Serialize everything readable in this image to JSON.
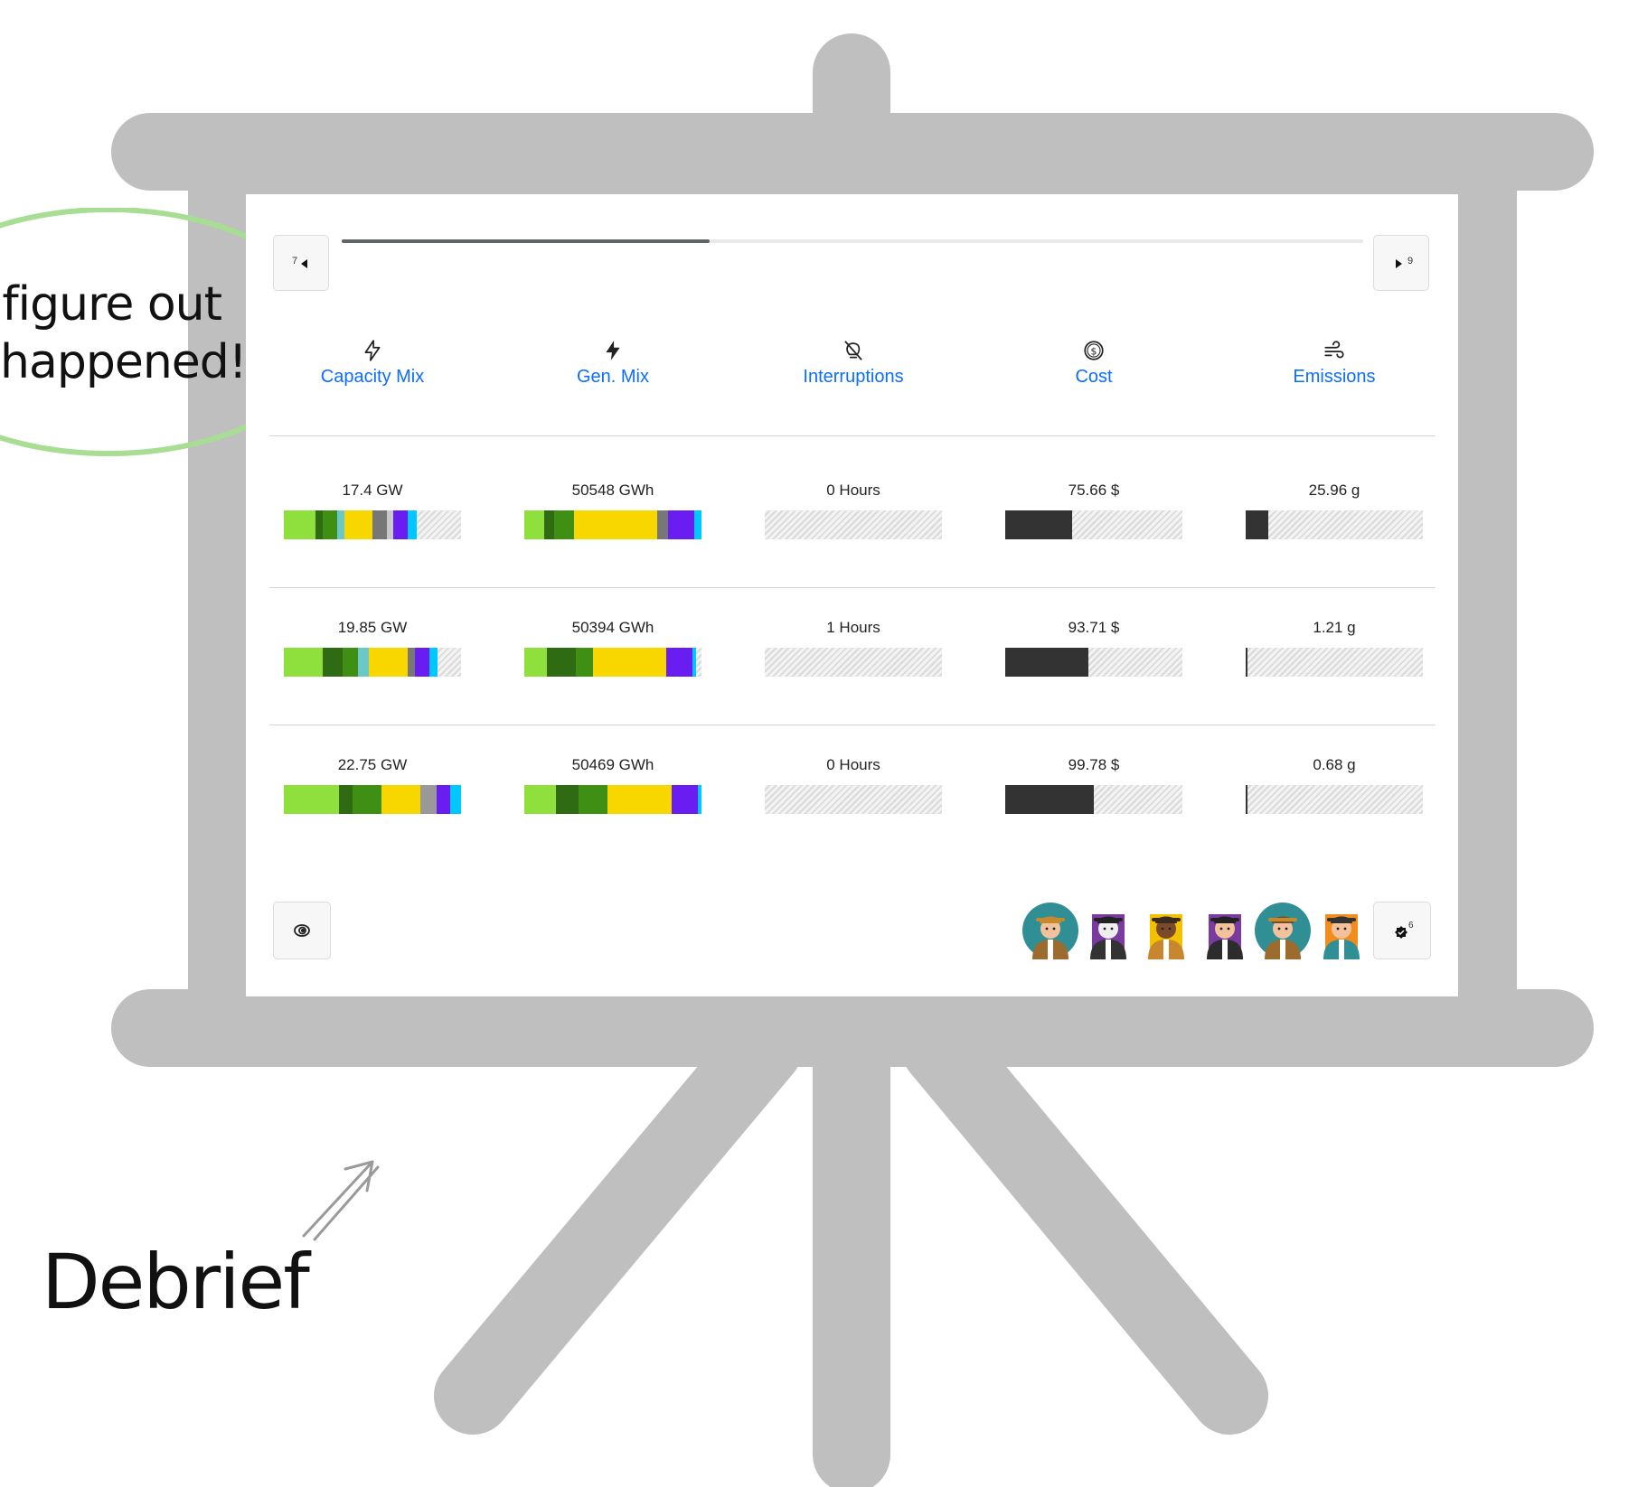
{
  "callout": {
    "line1": "figure out",
    "line2": "happened!"
  },
  "caption": "Debrief",
  "nav": {
    "prev_number": "7",
    "next_number": "9",
    "progress_fraction": 0.36
  },
  "columns": [
    {
      "label": "Capacity Mix",
      "icon": "lightning-outline-icon"
    },
    {
      "label": "Gen. Mix",
      "icon": "lightning-filled-icon"
    },
    {
      "label": "Interruptions",
      "icon": "bulb-off-icon"
    },
    {
      "label": "Cost",
      "icon": "dollar-coin-icon"
    },
    {
      "label": "Emissions",
      "icon": "wind-icon"
    }
  ],
  "rows": [
    {
      "capacity": {
        "label": "17.4 GW",
        "segments": [
          [
            "#8fe03c",
            0.18
          ],
          [
            "#2f6b12",
            0.04
          ],
          [
            "#3f8f15",
            0.08
          ],
          [
            "#6ac8c8",
            0.04
          ],
          [
            "#f8d700",
            0.16
          ],
          [
            "#777777",
            0.08
          ],
          [
            "#c9c9c9",
            0.04
          ],
          [
            "#6a1df0",
            0.08
          ],
          [
            "#00c8ff",
            0.05
          ]
        ]
      },
      "generation": {
        "label": "50548 GWh",
        "segments": [
          [
            "#8fe03c",
            0.11
          ],
          [
            "#2f6b12",
            0.06
          ],
          [
            "#3f8f15",
            0.11
          ],
          [
            "#f8d700",
            0.47
          ],
          [
            "#777777",
            0.06
          ],
          [
            "#6a1df0",
            0.15
          ],
          [
            "#00c8ff",
            0.04
          ]
        ]
      },
      "interruptions": {
        "label": "0 Hours",
        "fraction": 0
      },
      "cost": {
        "label": "75.66 $",
        "fraction": 0.38
      },
      "emissions": {
        "label": "25.96 g",
        "fraction": 0.13
      }
    },
    {
      "capacity": {
        "label": "19.85 GW",
        "segments": [
          [
            "#8fe03c",
            0.22
          ],
          [
            "#2f6b12",
            0.11
          ],
          [
            "#3f8f15",
            0.09
          ],
          [
            "#6ac8c8",
            0.06
          ],
          [
            "#f8d700",
            0.22
          ],
          [
            "#777777",
            0.04
          ],
          [
            "#6a1df0",
            0.08
          ],
          [
            "#00c8ff",
            0.05
          ]
        ]
      },
      "generation": {
        "label": "50394 GWh",
        "segments": [
          [
            "#8fe03c",
            0.13
          ],
          [
            "#2f6b12",
            0.16
          ],
          [
            "#3f8f15",
            0.1
          ],
          [
            "#f8d700",
            0.41
          ],
          [
            "#6a1df0",
            0.15
          ],
          [
            "#00c8ff",
            0.02
          ]
        ]
      },
      "interruptions": {
        "label": "1 Hours",
        "fraction": 0
      },
      "cost": {
        "label": "93.71 $",
        "fraction": 0.47
      },
      "emissions": {
        "label": "1.21 g",
        "fraction": 0
      }
    },
    {
      "capacity": {
        "label": "22.75 GW",
        "segments": [
          [
            "#8fe03c",
            0.31
          ],
          [
            "#2f6b12",
            0.08
          ],
          [
            "#3f8f15",
            0.16
          ],
          [
            "#f8d700",
            0.22
          ],
          [
            "#999999",
            0.09
          ],
          [
            "#6a1df0",
            0.08
          ],
          [
            "#00c8ff",
            0.06
          ]
        ]
      },
      "generation": {
        "label": "50469 GWh",
        "segments": [
          [
            "#8fe03c",
            0.18
          ],
          [
            "#2f6b12",
            0.13
          ],
          [
            "#3f8f15",
            0.17
          ],
          [
            "#f8d700",
            0.37
          ],
          [
            "#6a1df0",
            0.15
          ],
          [
            "#00c8ff",
            0.02
          ]
        ]
      },
      "interruptions": {
        "label": "0 Hours",
        "fraction": 0
      },
      "cost": {
        "label": "99.78 $",
        "fraction": 0.5
      },
      "emissions": {
        "label": "0.68 g",
        "fraction": 0
      }
    }
  ],
  "footer": {
    "left_icon": "spiral-eye-icon",
    "players": [
      "detective-woman-avatar",
      "masked-hacker-avatar",
      "curly-hair-person-avatar",
      "top-hat-man-avatar",
      "detective-man-avatar",
      "woman-bun-avatar"
    ],
    "count_badge": "6",
    "count_icon": "check-badge-icon"
  },
  "colors": {
    "frame": "#bfbfbf",
    "link_blue": "#0b6efd",
    "callout_outline": "#a8de94",
    "bar_dark": "#333333"
  }
}
